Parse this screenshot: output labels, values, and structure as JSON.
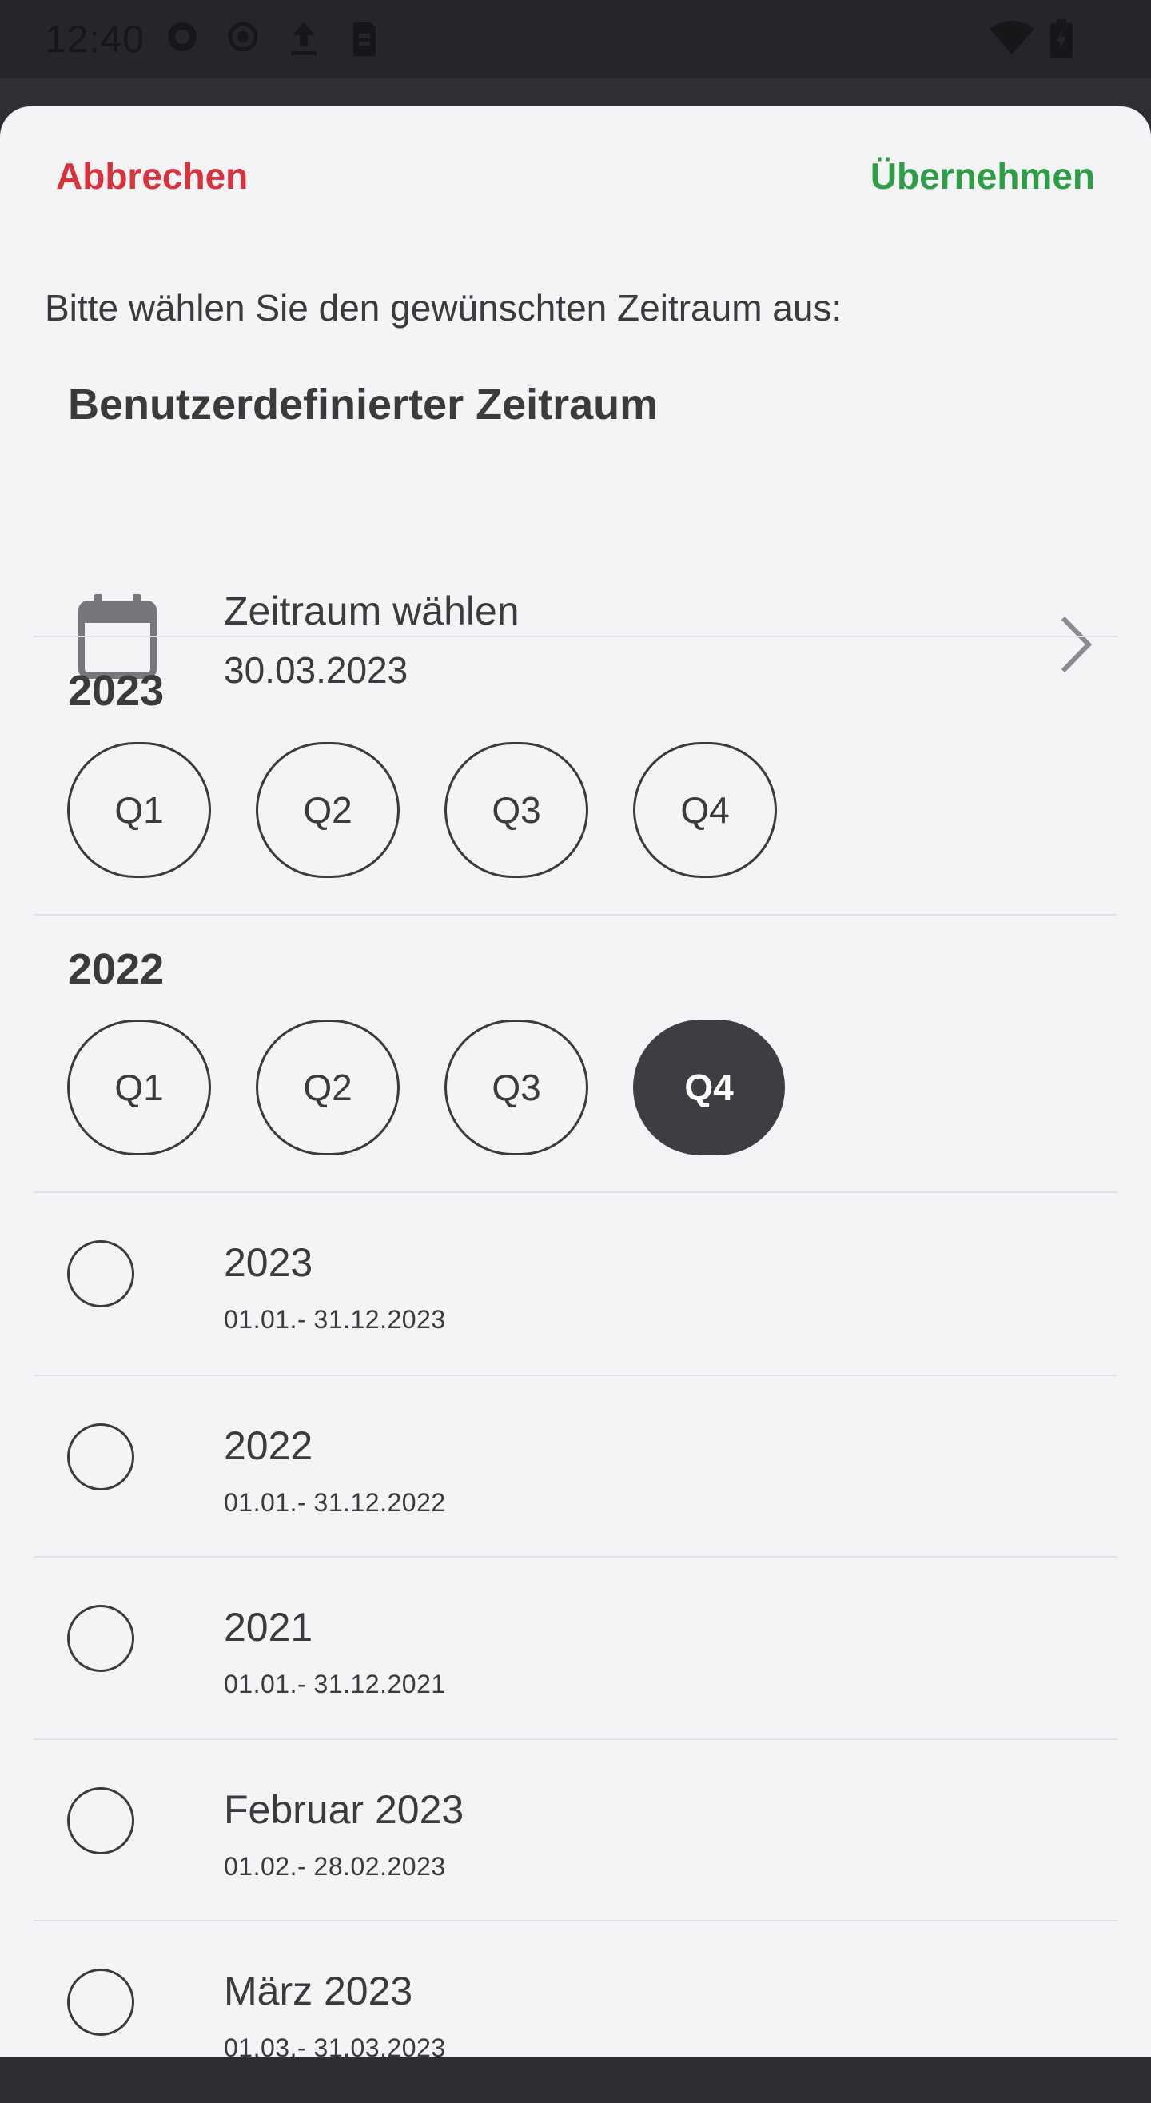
{
  "status_bar": {
    "time": "12:40",
    "icons": [
      "notification-app-icon",
      "record-icon",
      "upload-icon",
      "sim-icon",
      "wifi-icon",
      "battery-icon"
    ]
  },
  "header": {
    "cancel_label": "Abbrechen",
    "apply_label": "Übernehmen",
    "cancel_color": "#d8323c",
    "apply_color": "#2e9e46"
  },
  "prompt": "Bitte wählen Sie den gewünschten Zeitraum aus:",
  "custom_range": {
    "section_title": "Benutzerdefinierter Zeitraum",
    "label": "Zeitraum wählen",
    "value": "30.03.2023",
    "icon": "calendar-icon"
  },
  "years": [
    {
      "year": "2023",
      "quarters": [
        "Q1",
        "Q2",
        "Q3",
        "Q4"
      ],
      "selected": null
    },
    {
      "year": "2022",
      "quarters": [
        "Q1",
        "Q2",
        "Q3",
        "Q4"
      ],
      "selected": "Q4"
    }
  ],
  "periods": [
    {
      "title": "2023",
      "range": "01.01.- 31.12.2023"
    },
    {
      "title": "2022",
      "range": "01.01.- 31.12.2022"
    },
    {
      "title": "2021",
      "range": "01.01.- 31.12.2021"
    },
    {
      "title": "Februar 2023",
      "range": "01.02.- 28.02.2023"
    },
    {
      "title": "März 2023",
      "range": "01.03.- 31.03.2023"
    }
  ]
}
